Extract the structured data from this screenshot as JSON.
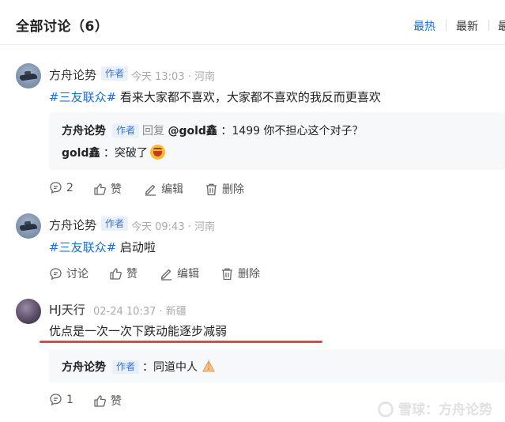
{
  "header": {
    "title": "全部讨论（6）",
    "sort_tabs": [
      "最热",
      "最新",
      "最"
    ],
    "active_sort": "最热"
  },
  "comments": [
    {
      "author": "方舟论势",
      "badge": "作者",
      "time": "今天 13:03",
      "location": "河南",
      "hashtag": "#三友联众#",
      "text": "看来大家都不喜欢，大家都不喜欢的我反而更喜欢",
      "replies": [
        {
          "author": "方舟论势",
          "badge": "作者",
          "reply_word": "回复",
          "target": "@gold鑫",
          "text": "：1499 你不担心这个对子？"
        },
        {
          "author": "gold鑫",
          "text": "：突破了"
        }
      ],
      "actions": {
        "comments": "2",
        "like": "赞",
        "edit": "编辑",
        "delete": "删除"
      }
    },
    {
      "author": "方舟论势",
      "badge": "作者",
      "time": "今天 09:43",
      "location": "河南",
      "hashtag": "#三友联众#",
      "text": "启动啦",
      "actions": {
        "comments": "讨论",
        "like": "赞",
        "edit": "编辑",
        "delete": "删除"
      }
    },
    {
      "author": "HJ天行",
      "time": "02-24 10:37",
      "location": "新疆",
      "text": "优点是一次一次下跌动能逐步减弱",
      "replies": [
        {
          "author": "方舟论势",
          "badge": "作者",
          "text": "：同道中人"
        }
      ],
      "actions": {
        "comments": "1",
        "like": "赞"
      }
    }
  ],
  "watermark": "雪球：方舟论势",
  "colors": {
    "link": "#1a6fcf",
    "badge_bg": "#e8f0fb",
    "underline": "#e8404f"
  }
}
